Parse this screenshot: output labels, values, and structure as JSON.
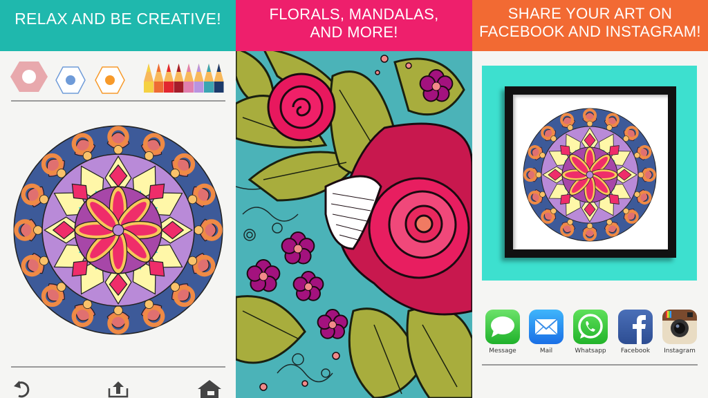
{
  "panels": [
    {
      "banner": "RELAX AND BE CREATIVE!",
      "banner_color": "#1fb8ad",
      "tools": [
        {
          "name": "eraser",
          "color": "#e8a9ad"
        },
        {
          "name": "brush-small",
          "color": "#6f9bd8"
        },
        {
          "name": "brush-medium",
          "color": "#f79a2b"
        }
      ],
      "pencil_colors": [
        "#f5d142",
        "#ee6c33",
        "#e2272f",
        "#a51d2a",
        "#e17fae",
        "#b993e0",
        "#3ba5b2",
        "#1c3a6b"
      ],
      "toolbar": {
        "undo": "undo-icon",
        "share": "share-icon",
        "home": "home-icon"
      }
    },
    {
      "banner_line1": "FLORALS, MANDALAS,",
      "banner_line2": "AND MORE!",
      "banner_color": "#ee1f6c"
    },
    {
      "banner_line1": "SHARE YOUR ART ON",
      "banner_line2": "FACEBOOK AND INSTAGRAM!",
      "banner_color": "#f26a33",
      "share_targets": [
        {
          "label": "Message",
          "icon": "message-icon"
        },
        {
          "label": "Mail",
          "icon": "mail-icon"
        },
        {
          "label": "Whatsapp",
          "icon": "whatsapp-icon"
        },
        {
          "label": "Facebook",
          "icon": "facebook-icon"
        },
        {
          "label": "Instagram",
          "icon": "instagram-icon"
        }
      ]
    }
  ]
}
